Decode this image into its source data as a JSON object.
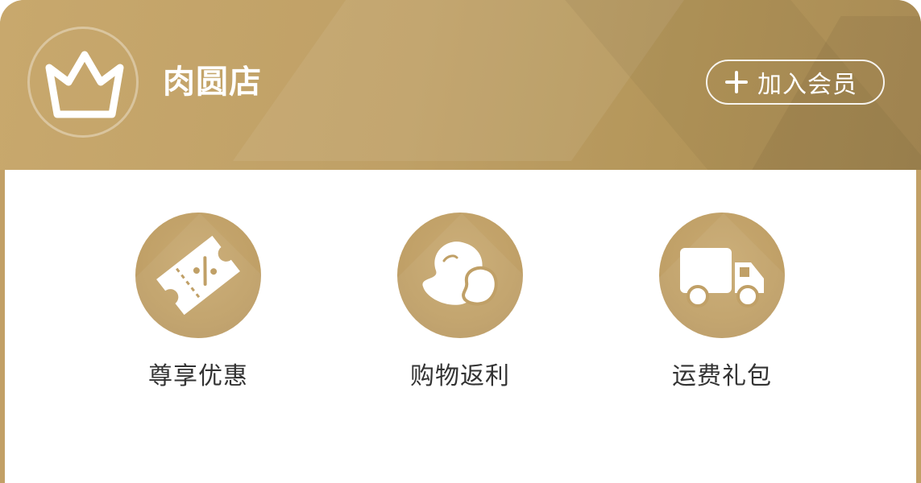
{
  "header": {
    "shop_name": "肉圆店",
    "join_label": "加入会员",
    "badge_icon": "crown-icon",
    "plus_icon": "plus-icon"
  },
  "benefits": [
    {
      "label": "尊享优惠",
      "icon": "discount-ticket-icon"
    },
    {
      "label": "购物返利",
      "icon": "beans-icon"
    },
    {
      "label": "运费礼包",
      "icon": "delivery-truck-icon"
    }
  ],
  "colors": {
    "gold": "#c2a066",
    "text": "#333333",
    "white": "#ffffff"
  }
}
